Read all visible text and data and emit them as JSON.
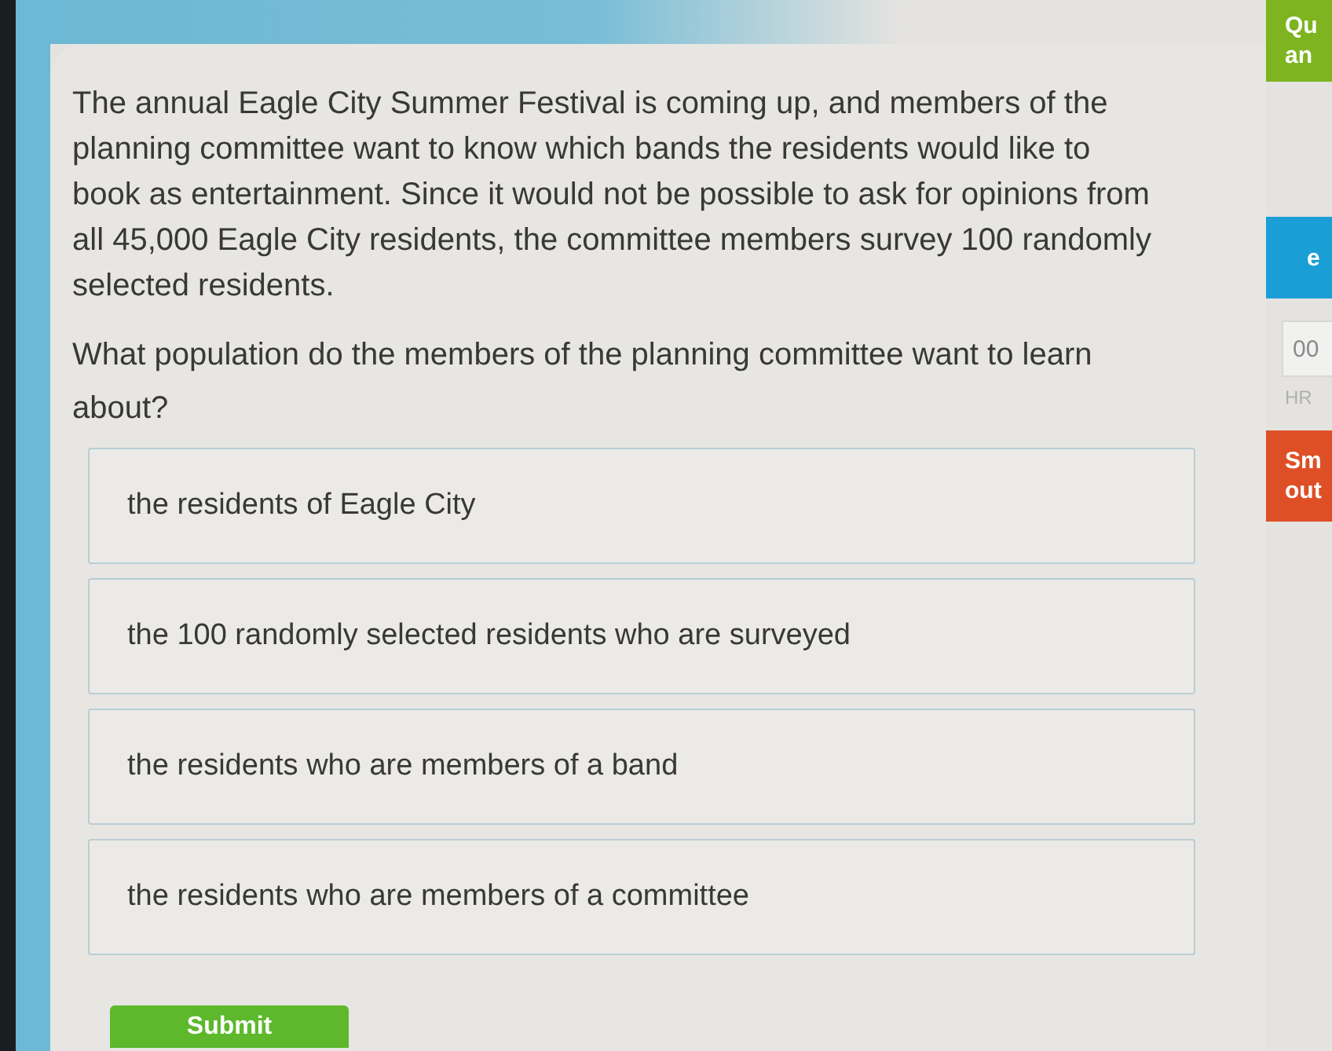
{
  "passage": "The annual Eagle City Summer Festival is coming up, and members of the planning committee want to know which bands the residents would like to book as entertainment. Since it would not be possible to ask for opinions from all 45,000 Eagle City residents, the committee members survey 100 randomly selected residents.",
  "question": "What population do the members of the planning committee want to learn about?",
  "options": [
    {
      "label": "the residents of Eagle City",
      "selected": false
    },
    {
      "label": "the 100 randomly selected residents who are surveyed",
      "selected": false
    },
    {
      "label": "the residents who are members of a band",
      "selected": false
    },
    {
      "label": "the residents who are members of a committee",
      "selected": false
    }
  ],
  "submit": {
    "label": "Submit"
  },
  "sidebar": {
    "panel_1": {
      "lines": [
        "Qu",
        "an"
      ]
    },
    "panel_2": {
      "lines": [
        "e"
      ]
    },
    "timer": {
      "value": "00",
      "unit": "HR"
    },
    "panel_3": {
      "lines": [
        "Sm",
        "out"
      ]
    }
  }
}
